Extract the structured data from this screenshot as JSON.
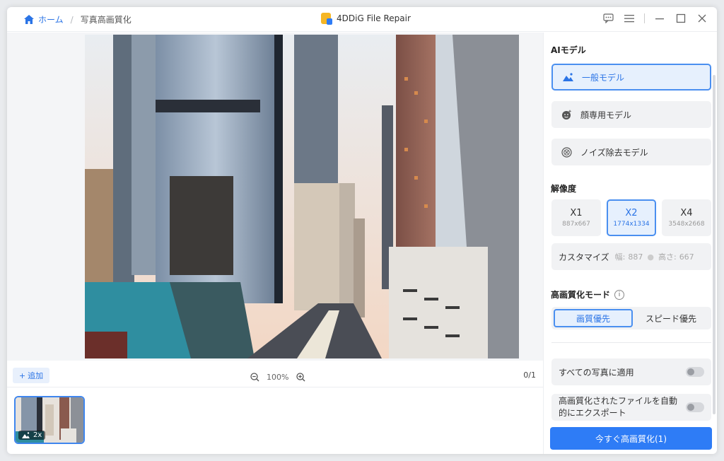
{
  "titlebar": {
    "home_label": "ホーム",
    "separator": "/",
    "current": "写真高画質化",
    "app_title": "4DDiG File Repair"
  },
  "canvas": {
    "add_label": "追加",
    "add_plus": "+",
    "zoom_level": "100%",
    "pager": "0/1"
  },
  "thumbnail": {
    "badge": "2x"
  },
  "panel": {
    "ai_model_title": "AIモデル",
    "models": [
      {
        "label": "一般モデル",
        "icon": "landscape-icon",
        "active": true
      },
      {
        "label": "顔専用モデル",
        "icon": "face-icon",
        "active": false
      },
      {
        "label": "ノイズ除去モデル",
        "icon": "noise-icon",
        "active": false
      }
    ],
    "resolution_title": "解像度",
    "resolutions": [
      {
        "label": "X1",
        "size": "887x667",
        "active": false
      },
      {
        "label": "X2",
        "size": "1774x1334",
        "active": true
      },
      {
        "label": "X4",
        "size": "3548x2668",
        "active": false
      }
    ],
    "custom_label": "カスタマイズ",
    "width_label": "幅:",
    "width_value": "887",
    "height_label": "高さ:",
    "height_value": "667",
    "mode_title": "高画質化モード",
    "info_glyph": "i",
    "modes": [
      {
        "label": "画質優先",
        "active": true
      },
      {
        "label": "スピード優先",
        "active": false
      }
    ],
    "apply_all": "すべての写真に適用",
    "auto_export": "高画質化されたファイルを自動的にエクスポート",
    "enhance_button": "今すぐ高画質化(1)"
  },
  "colors": {
    "accent": "#2e7cf6",
    "active_bg": "#e6f0fd"
  }
}
